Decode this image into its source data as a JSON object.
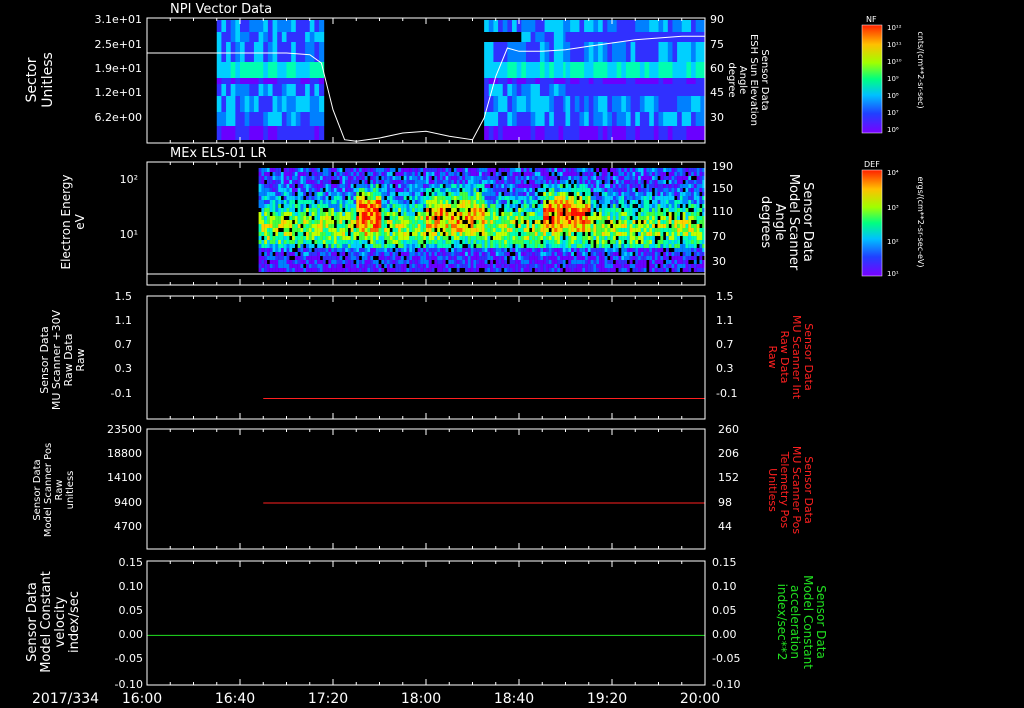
{
  "date_label": "2017/334",
  "time_ticks": [
    "16:00",
    "16:40",
    "17:20",
    "18:00",
    "18:40",
    "19:20",
    "20:00"
  ],
  "panels": [
    {
      "title": "NPI Vector Data",
      "left_label": [
        "Sector",
        "Unitless"
      ],
      "left_ticks": [
        "3.1e+01",
        "2.5e+01",
        "1.9e+01",
        "1.2e+01",
        "6.2e+00"
      ],
      "right_ticks": [
        "90",
        "75",
        "60",
        "45",
        "30"
      ],
      "right_label": [
        "Sensor Data",
        "ESH Sun Elevation",
        "Angle",
        "degree"
      ],
      "colorbar": {
        "label": "NF",
        "unit": "cnts/(cm**2-sr-sec)",
        "ticks": [
          "10¹²",
          "10¹¹",
          "10¹⁰",
          "10⁹",
          "10⁸",
          "10⁷",
          "10⁶"
        ]
      }
    },
    {
      "title": "MEx ELS-01 LR",
      "left_label": [
        "Electron Energy",
        "eV"
      ],
      "left_ticks": [
        "10²",
        "10¹"
      ],
      "right_ticks": [
        "190",
        "150",
        "110",
        "70",
        "30"
      ],
      "right_label": [
        "Sensor Data",
        "Model Scanner",
        "Angle",
        "degrees"
      ],
      "colorbar": {
        "label": "DEF",
        "unit": "ergs/(cm**2-sr-sec-eV)",
        "ticks": [
          "10⁴",
          "10³",
          "10²",
          "10¹"
        ]
      }
    },
    {
      "left_label": [
        "Sensor Data",
        "MU Scanner +30V",
        "Raw Data",
        "Raw"
      ],
      "left_ticks": [
        "1.5",
        "1.1",
        "0.7",
        "0.3",
        "-0.1"
      ],
      "right_ticks": [
        "1.5",
        "1.1",
        "0.7",
        "0.3",
        "-0.1"
      ],
      "right_label": [
        "Sensor Data",
        "MU Scanner Int",
        "Raw Data",
        "Raw"
      ]
    },
    {
      "left_label": [
        "Sensor Data",
        "Model Scanner Pos",
        "Raw",
        "unitless"
      ],
      "left_ticks": [
        "23500",
        "18800",
        "14100",
        "9400",
        "4700"
      ],
      "right_ticks": [
        "260",
        "206",
        "152",
        "98",
        "44"
      ],
      "right_label": [
        "Sensor Data",
        "MU Scanner Pos",
        "Telemetry Pos",
        "Unitless"
      ]
    },
    {
      "left_label": [
        "Sensor Data",
        "Model Constant",
        "velocity",
        "index/sec"
      ],
      "left_ticks": [
        "0.15",
        "0.10",
        "0.05",
        "0.00",
        "-0.05",
        "-0.10"
      ],
      "right_ticks": [
        "0.15",
        "0.10",
        "0.05",
        "0.00",
        "-0.05",
        "-0.10"
      ],
      "right_label": [
        "Sensor Data",
        "Model Constant",
        "acceleration",
        "index/sec**2"
      ]
    }
  ],
  "colors": {
    "red_line": "#ff2020",
    "green_line": "#20e020",
    "frame": "#ffffff"
  },
  "chart_data": [
    {
      "type": "line",
      "title": "NPI Vector Data",
      "note_spectrogram": "NF spectrogram, x: time, y: Sector",
      "x": [
        "16:00",
        "16:10",
        "16:20",
        "16:30",
        "16:40",
        "16:50",
        "17:00",
        "17:10",
        "17:15",
        "17:20",
        "17:25",
        "17:30",
        "17:40",
        "17:50",
        "18:00",
        "18:10",
        "18:20",
        "18:25",
        "18:30",
        "18:35",
        "18:40",
        "18:50",
        "19:00",
        "19:10",
        "19:20",
        "19:30",
        "19:40",
        "19:50",
        "20:00"
      ],
      "series": [
        {
          "name": "ESH Sun Elevation Angle",
          "values": [
            69,
            69,
            69,
            69,
            69,
            69,
            69,
            68,
            63,
            35,
            17,
            16,
            18,
            21,
            22,
            19,
            17,
            30,
            55,
            72,
            70,
            70,
            71,
            73,
            75,
            77,
            78,
            79,
            79
          ]
        }
      ],
      "xlim": [
        "16:00",
        "20:00"
      ],
      "ylim_left": [
        0,
        31
      ],
      "ylim_right": [
        15,
        90
      ]
    },
    {
      "type": "heatmap",
      "title": "MEx ELS-01 LR",
      "ylabel": "Electron Energy eV",
      "xlim": [
        "16:00",
        "20:00"
      ],
      "ylim_right": [
        10,
        190
      ],
      "series": [
        {
          "name": "baseline",
          "values": [
            10,
            10
          ]
        }
      ]
    },
    {
      "type": "line",
      "x": [
        "16:50",
        "20:00"
      ],
      "series": [
        {
          "name": "",
          "values": [
            0,
            0
          ]
        }
      ],
      "ylim": [
        -0.3,
        1.5
      ]
    },
    {
      "type": "line",
      "x": [
        "16:50",
        "20:00"
      ],
      "series": [
        {
          "name": "",
          "values": [
            9000,
            9000
          ]
        }
      ],
      "ylim": [
        0,
        23500
      ]
    },
    {
      "type": "line",
      "x": [
        "16:00",
        "20:00"
      ],
      "series": [
        {
          "name": "",
          "values": [
            0.0,
            0.0
          ]
        }
      ],
      "ylim": [
        -0.1,
        0.15
      ]
    }
  ]
}
